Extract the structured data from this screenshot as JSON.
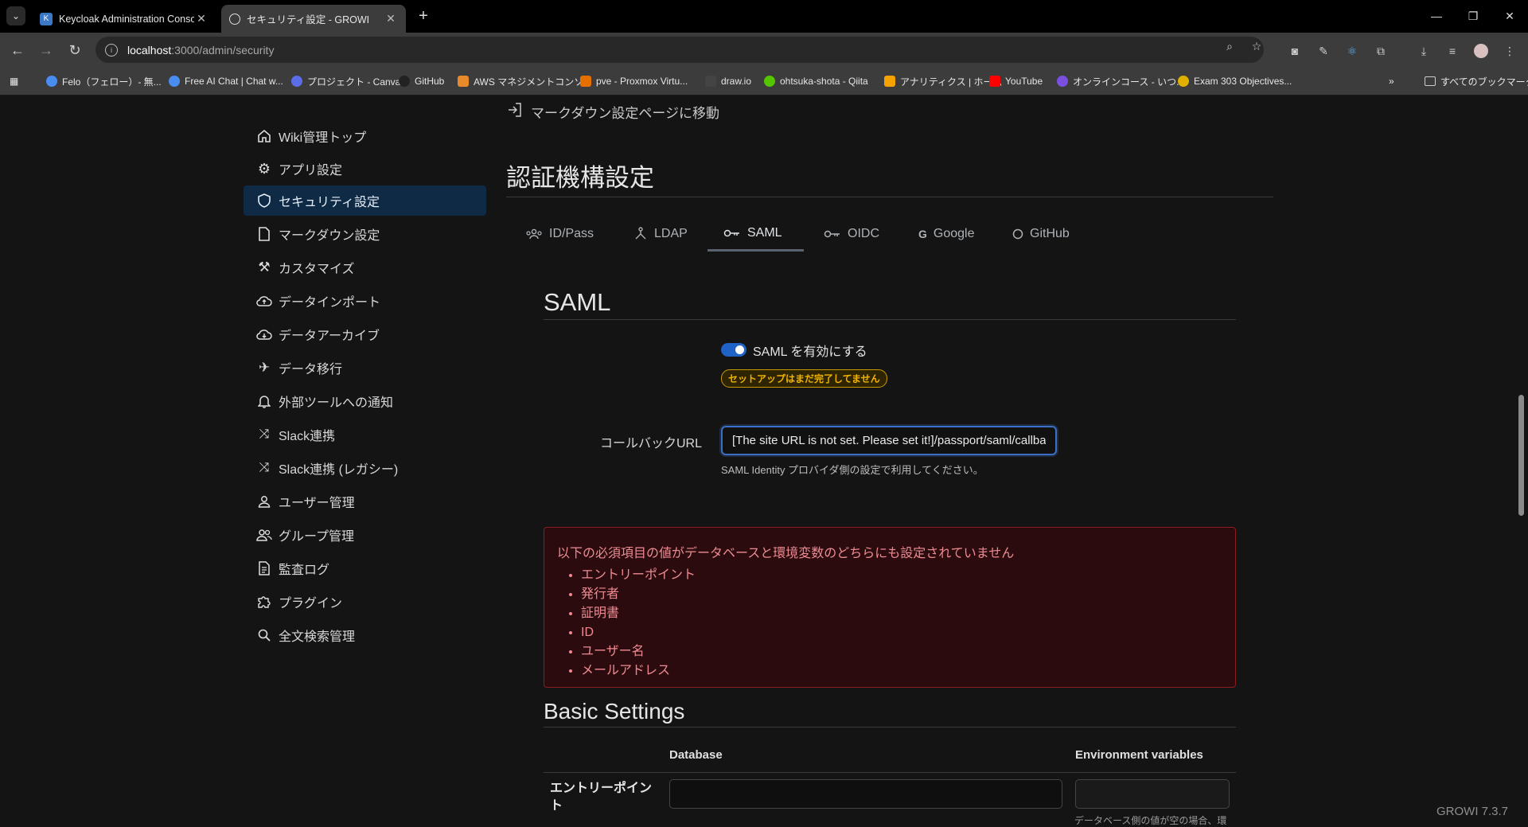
{
  "browser": {
    "tabs": [
      {
        "title": "Keycloak Administration Console",
        "active": false
      },
      {
        "title": "セキュリティ設定 - GROWI",
        "active": true
      }
    ],
    "url_host": "localhost",
    "url_path": ":3000/admin/security",
    "bookmarks": [
      "Felo（フェロー）- 無...",
      "Free AI Chat | Chat w...",
      "プロジェクト - Canva",
      "GitHub",
      "AWS マネジメントコンソ...",
      "pve - Proxmox Virtu...",
      "draw.io",
      "ohtsuka-shota - Qiita",
      "アナリティクス | ホーム",
      "YouTube",
      "オンラインコース - いつ...",
      "Exam 303 Objectives..."
    ],
    "all_bookmarks": "すべてのブックマーク"
  },
  "sidebar": {
    "items": [
      {
        "label": "Wiki管理トップ",
        "icon": "home-icon"
      },
      {
        "label": "アプリ設定",
        "icon": "gear-icon"
      },
      {
        "label": "セキュリティ設定",
        "icon": "shield-icon",
        "active": true
      },
      {
        "label": "マークダウン設定",
        "icon": "document-icon"
      },
      {
        "label": "カスタマイズ",
        "icon": "tools-icon"
      },
      {
        "label": "データインポート",
        "icon": "cloud-upload-icon"
      },
      {
        "label": "データアーカイブ",
        "icon": "cloud-download-icon"
      },
      {
        "label": "データ移行",
        "icon": "airplane-icon"
      },
      {
        "label": "外部ツールへの通知",
        "icon": "bell-icon"
      },
      {
        "label": "Slack連携",
        "icon": "shuffle-icon"
      },
      {
        "label": "Slack連携 (レガシー)",
        "icon": "shuffle-icon"
      },
      {
        "label": "ユーザー管理",
        "icon": "user-icon"
      },
      {
        "label": "グループ管理",
        "icon": "group-icon"
      },
      {
        "label": "監査ログ",
        "icon": "log-icon"
      },
      {
        "label": "プラグイン",
        "icon": "puzzle-icon"
      },
      {
        "label": "全文検索管理",
        "icon": "search-icon"
      }
    ]
  },
  "main": {
    "markdown_link": "マークダウン設定ページに移動",
    "page_title": "認証機構設定",
    "tabs": [
      {
        "label": "ID/Pass",
        "icon": "users-icon"
      },
      {
        "label": "LDAP",
        "icon": "network-icon"
      },
      {
        "label": "SAML",
        "icon": "key-icon",
        "active": true
      },
      {
        "label": "OIDC",
        "icon": "key-icon"
      },
      {
        "label": "Google",
        "icon": "google-icon"
      },
      {
        "label": "GitHub",
        "icon": "github-icon"
      }
    ],
    "saml": {
      "title": "SAML",
      "toggle_label": "SAML を有効にする",
      "toggle_on": true,
      "setup_badge": "セットアップはまだ完了してません",
      "callback_label": "コールバックURL",
      "callback_value": "[The site URL is not set. Please set it!]/passport/saml/callback",
      "callback_help": "SAML Identity プロバイダ側の設定で利用してください。"
    },
    "alert": {
      "message": "以下の必須項目の値がデータベースと環境変数のどちらにも設定されていません",
      "items": [
        "エントリーポイント",
        "発行者",
        "証明書",
        "ID",
        "ユーザー名",
        "メールアドレス"
      ]
    },
    "basic_settings": {
      "title": "Basic Settings",
      "col_database": "Database",
      "col_env": "Environment variables",
      "row_entry_point": "エントリーポイント",
      "env_help": "データベース側の値が空の場合、環"
    }
  },
  "footer": {
    "version": "GROWI 7.3.7"
  },
  "colors": {
    "accent": "#1f63c6",
    "sidebar_active": "#0e2a45",
    "alert_border": "#8a1c24",
    "alert_text": "#ee8b92",
    "warning": "#f0b400"
  }
}
